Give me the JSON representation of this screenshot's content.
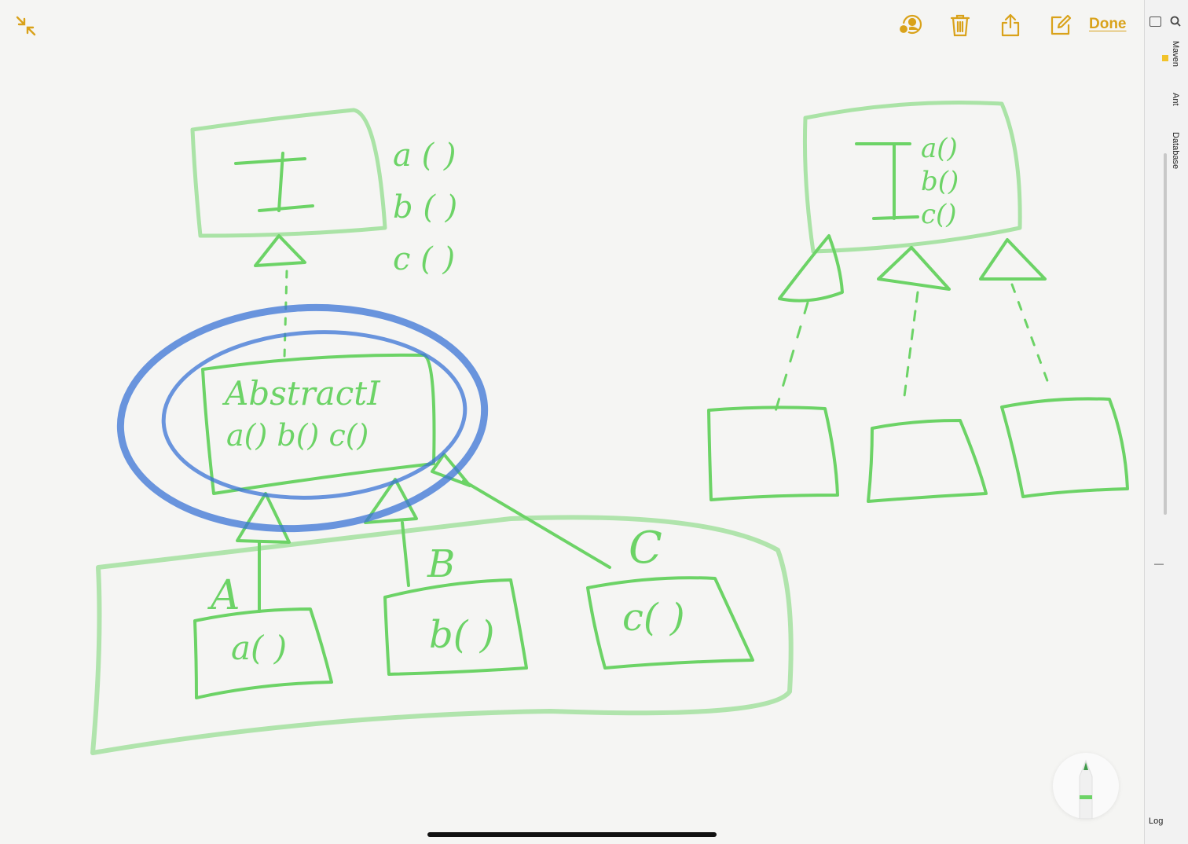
{
  "toolbar": {
    "done_label": "Done",
    "icons": [
      "collapse-icon",
      "collaborate-icon",
      "trash-icon",
      "share-icon",
      "compose-icon"
    ],
    "accent": "#d9a21a"
  },
  "sidebar": {
    "tabs": [
      {
        "label": "Maven"
      },
      {
        "label": "Ant"
      },
      {
        "label": "Database"
      }
    ],
    "bottom_tab": "Log",
    "minus_label": "—"
  },
  "sketch": {
    "left": {
      "interface_label": "I",
      "interface_methods": [
        "a ( )",
        "b ( )",
        "c ( )"
      ],
      "abstract_title": "AbstractI",
      "abstract_methods": "a() b() c()",
      "class_labels": [
        "A",
        "B",
        "C"
      ],
      "class_methods": [
        "a( )",
        "b( )",
        "c( )"
      ]
    },
    "right": {
      "interface_label": "I",
      "interface_methods": [
        "a()",
        "b()",
        "c()"
      ]
    },
    "colors": {
      "green": "#6cd366",
      "blue": "#3b74d6"
    }
  }
}
